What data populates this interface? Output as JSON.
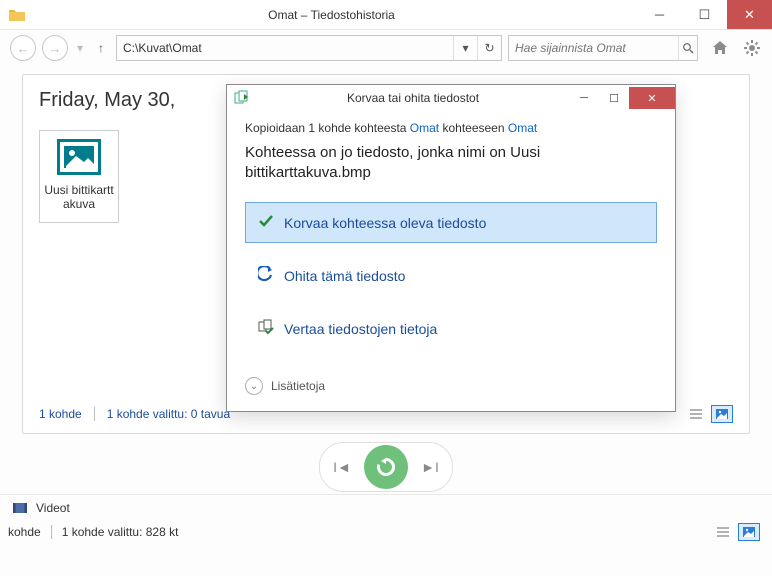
{
  "window": {
    "title": "Omat – Tiedostohistoria"
  },
  "toolbar": {
    "address": "C:\\Kuvat\\Omat",
    "search_placeholder": "Hae sijainnista Omat"
  },
  "panel": {
    "date": "Friday, May 30,",
    "file_thumb_label": "Uusi bittikarttakuva",
    "status_items": "1 kohde",
    "status_selected": "1 kohde valittu: 0 tavua"
  },
  "footer": {
    "location_label": "Videot",
    "status_items": "kohde",
    "status_selected": "1 kohde valittu: 828 kt"
  },
  "dialog": {
    "title": "Korvaa tai ohita tiedostot",
    "crumb_prefix": "Kopioidaan 1 kohde kohteesta ",
    "crumb_src": "Omat",
    "crumb_mid": " kohteeseen ",
    "crumb_dst": "Omat",
    "message": "Kohteessa on jo tiedosto, jonka nimi on Uusi bittikarttakuva.bmp",
    "action_replace": "Korvaa kohteessa oleva tiedosto",
    "action_skip": "Ohita tämä tiedosto",
    "action_compare": "Vertaa tiedostojen tietoja",
    "more": "Lisätietoja"
  }
}
